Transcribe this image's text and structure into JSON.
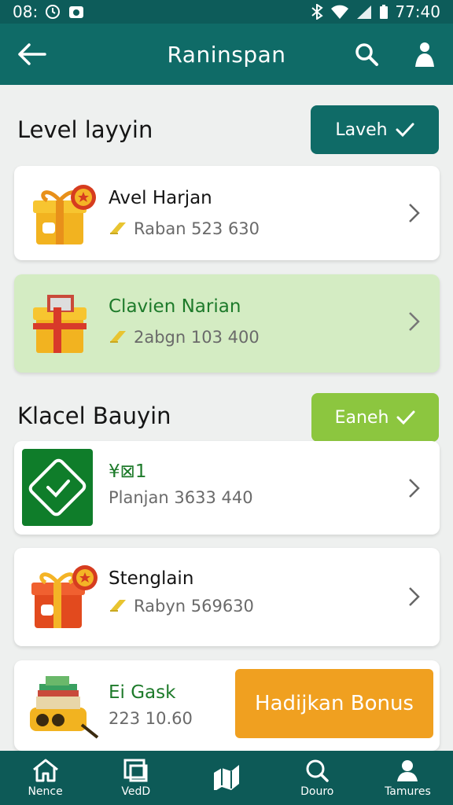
{
  "status_bar": {
    "time_left": "08:",
    "time_right": "77:40"
  },
  "app_bar": {
    "title": "Raninspan"
  },
  "section1": {
    "title": "Level layyin",
    "button_label": "Laveh"
  },
  "section2": {
    "title": "Klacel Bauyin",
    "button_label": "Eaneh"
  },
  "cards": [
    {
      "name": "Avel Harjan",
      "sub": "Raban 523 630"
    },
    {
      "name": "Clavien Narian",
      "sub": "2abgn 103 400"
    },
    {
      "name": "¥⊠1",
      "sub": "Planjan 3633 440"
    },
    {
      "name": "Stenglain",
      "sub": "Rabyn 569630"
    },
    {
      "name": "Ei Gask",
      "sub": "223 10.60"
    }
  ],
  "bonus_button_label": "Hadijkan Bonus",
  "bottom_nav": [
    {
      "label": "Nence"
    },
    {
      "label": "VedD"
    },
    {
      "label": ""
    },
    {
      "label": "Douro"
    },
    {
      "label": "Tamures"
    }
  ],
  "colors": {
    "header": "#0f6b67",
    "highlight_card": "#d4ecc3",
    "section2_button": "#8cc63f",
    "bonus": "#f0a020",
    "green_tile": "#0f7d2a"
  }
}
